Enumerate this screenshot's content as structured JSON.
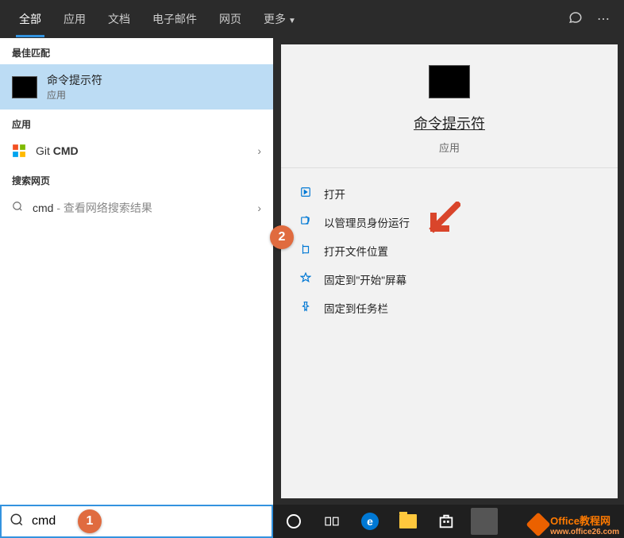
{
  "tabs": {
    "items": [
      {
        "label": "全部",
        "active": true
      },
      {
        "label": "应用",
        "active": false
      },
      {
        "label": "文档",
        "active": false
      },
      {
        "label": "电子邮件",
        "active": false
      },
      {
        "label": "网页",
        "active": false
      },
      {
        "label": "更多",
        "active": false,
        "dropdown": true
      }
    ]
  },
  "sections": {
    "best_match": "最佳匹配",
    "apps": "应用",
    "web": "搜索网页"
  },
  "best_match": {
    "title": "命令提示符",
    "subtitle": "应用"
  },
  "apps": {
    "items": [
      {
        "prefix": "Git ",
        "bold": "CMD"
      }
    ]
  },
  "web_search": {
    "query": "cmd",
    "hint": " - 查看网络搜索结果"
  },
  "detail": {
    "title": "命令提示符",
    "subtitle": "应用",
    "actions": [
      {
        "icon": "open",
        "label": "打开"
      },
      {
        "icon": "admin",
        "label": "以管理员身份运行"
      },
      {
        "icon": "location",
        "label": "打开文件位置"
      },
      {
        "icon": "pin-start",
        "label": "固定到\"开始\"屏幕"
      },
      {
        "icon": "pin-taskbar",
        "label": "固定到任务栏"
      }
    ]
  },
  "search": {
    "value": "cmd"
  },
  "annotations": {
    "badge1": "1",
    "badge2": "2"
  },
  "watermark": {
    "text": "Office教程网",
    "url": "www.office26.com"
  }
}
